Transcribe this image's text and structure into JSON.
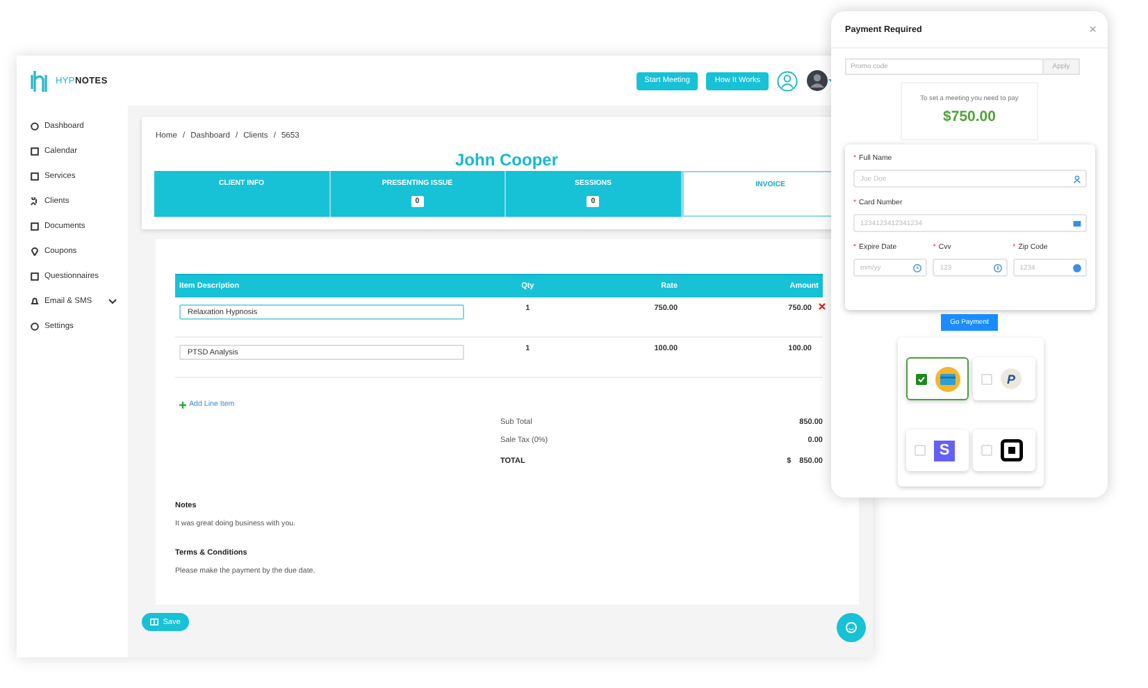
{
  "app": {
    "logo": "HYP**NOTES**"
  },
  "header": {
    "buttons": [
      "Start Meeting",
      "How It Works"
    ]
  },
  "sidebar": {
    "items": [
      {
        "label": "Dashboard",
        "has_submenu": false
      },
      {
        "label": "Calendar",
        "has_submenu": false
      },
      {
        "label": "Services",
        "has_submenu": false
      },
      {
        "label": "Clients",
        "has_submenu": false
      },
      {
        "label": "Documents",
        "has_submenu": false
      },
      {
        "label": "Coupons",
        "has_submenu": false
      },
      {
        "label": "Questionnaires",
        "has_submenu": false
      },
      {
        "label": "Email & SMS",
        "has_submenu": true
      },
      {
        "label": "Settings",
        "has_submenu": false
      }
    ]
  },
  "breadcrumb": {
    "separator": "/",
    "items": [
      "Home",
      "Dashboard",
      "Clients",
      "5653"
    ]
  },
  "client_name": "John Cooper",
  "tabs": [
    {
      "label": "CLIENT INFO",
      "selected": false
    },
    {
      "label": "PRESENTING ISSUE",
      "count": "0",
      "selected": false
    },
    {
      "label": "SESSIONS",
      "count": "0",
      "selected": false
    },
    {
      "label": "INVOICE",
      "selected": true
    }
  ],
  "invoice": {
    "columns": [
      "Item Description",
      "Qty",
      "Rate",
      "Amount"
    ],
    "rows": [
      {
        "description": "Relaxation Hypnosis",
        "qty": "1",
        "rate": "750.00",
        "amount": "750.00",
        "removable": true,
        "focused": true
      },
      {
        "description": "PTSD Analysis",
        "qty": "1",
        "rate": "100.00",
        "amount": "100.00",
        "removable": false,
        "focused": false
      }
    ],
    "add_line_item": "Add Line Item",
    "totals": [
      {
        "label": "Sub Total",
        "value": "850.00",
        "kind": "plain"
      },
      {
        "label": "Sale Tax (0%)",
        "value": "0.00",
        "kind": "plain"
      },
      {
        "label": "TOTAL",
        "currency": "$",
        "value": "850.00",
        "kind": "total"
      }
    ],
    "notes_title": "Notes",
    "notes": "It was great doing business with you.",
    "terms_title": "Terms & Conditions",
    "terms": "Please make the payment by the due date."
  },
  "save_button": "Save",
  "payment_dialog": {
    "title": "Payment Required",
    "close": "×",
    "promo": {
      "placeholder": "Promo code",
      "button": "Apply"
    },
    "notice": "To set a meeting you need to pay",
    "amount": "$750.00",
    "fields": [
      {
        "label": "Full Name",
        "placeholder": "Joe Doe",
        "required_mark": "*",
        "kind": "wide"
      },
      {
        "label": "Card Number",
        "placeholder": "1234123412341234",
        "required_mark": "*",
        "kind": "wide"
      },
      {
        "label": "Expire Date",
        "placeholder": "mm/yy",
        "required_mark": "*",
        "kind": "third"
      },
      {
        "label": "Cvv",
        "placeholder": "123",
        "required_mark": "*",
        "kind": "third"
      },
      {
        "label": "Zip Code",
        "placeholder": "1234",
        "required_mark": "*",
        "kind": "third"
      }
    ],
    "pay_button": "Go Payment",
    "methods": [
      {
        "kind": "card",
        "checked": true
      },
      {
        "kind": "paypal",
        "mark": "P",
        "checked": false
      },
      {
        "kind": "stripe",
        "mark": "S",
        "checked": false
      },
      {
        "kind": "square",
        "checked": false
      }
    ]
  }
}
